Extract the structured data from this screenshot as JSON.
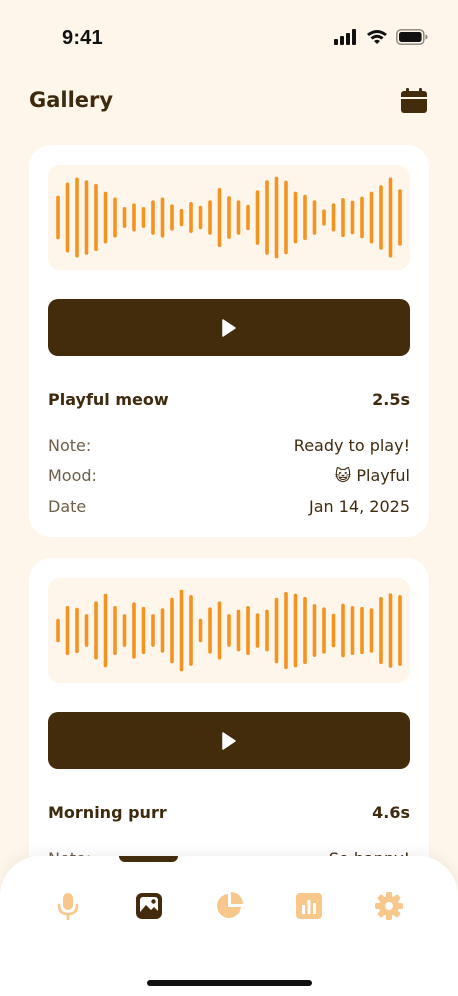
{
  "status_bar": {
    "time": "9:41",
    "signal_icon": "cellular-signal-icon",
    "wifi_icon": "wifi-icon",
    "battery_icon": "battery-icon"
  },
  "header": {
    "title": "Gallery",
    "calendar_icon": "calendar-icon"
  },
  "colors": {
    "background": "#FEF6EA",
    "card": "#FFFFFF",
    "dark_brown": "#432C0C",
    "accent_orange": "#F39322",
    "muted_orange": "#F7C78C"
  },
  "recordings": [
    {
      "title": "Playful meow",
      "duration": "2.5s",
      "note_label": "Note:",
      "note": "Ready to play!",
      "mood_label": "Mood:",
      "mood_emoji": "😺",
      "mood": "Playful",
      "date_label": "Date",
      "date": "Jan 14, 2025",
      "waveform": [
        0.44,
        0.73,
        0.84,
        0.78,
        0.7,
        0.53,
        0.4,
        0.19,
        0.27,
        0.19,
        0.34,
        0.4,
        0.25,
        0.15,
        0.3,
        0.22,
        0.34,
        0.61,
        0.43,
        0.34,
        0.24,
        0.56,
        0.78,
        0.86,
        0.77,
        0.53,
        0.46,
        0.34,
        0.14,
        0.27,
        0.39,
        0.33,
        0.42,
        0.53,
        0.67,
        0.84,
        0.58
      ]
    },
    {
      "title": "Morning purr",
      "duration": "4.6s",
      "note_label": "Note:",
      "note": "So happy!"
    }
  ],
  "waveform_2": [
    0.22,
    0.5,
    0.46,
    0.32,
    0.6,
    0.77,
    0.5,
    0.32,
    0.58,
    0.48,
    0.32,
    0.45,
    0.68,
    0.86,
    0.74,
    0.22,
    0.47,
    0.6,
    0.32,
    0.42,
    0.5,
    0.34,
    0.42,
    0.68,
    0.81,
    0.77,
    0.7,
    0.54,
    0.47,
    0.33,
    0.55,
    0.5,
    0.48,
    0.45,
    0.7,
    0.78,
    0.74
  ],
  "tab_bar": {
    "items": [
      {
        "name": "record",
        "icon": "microphone-icon",
        "active": false
      },
      {
        "name": "gallery",
        "icon": "gallery-icon",
        "active": true
      },
      {
        "name": "mood-stats",
        "icon": "pie-chart-icon",
        "active": false
      },
      {
        "name": "reports",
        "icon": "bar-chart-icon",
        "active": false
      },
      {
        "name": "settings",
        "icon": "gear-icon",
        "active": false
      }
    ]
  }
}
